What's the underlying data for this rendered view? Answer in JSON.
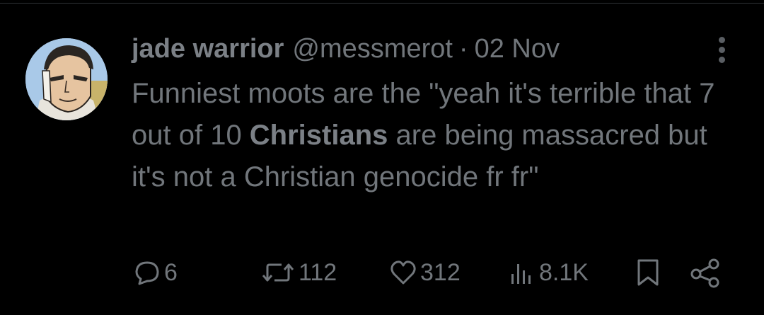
{
  "tweet": {
    "author": {
      "name": "jade warrior",
      "handle": "@messmerot"
    },
    "separator": "·",
    "date": "02 Nov",
    "text": {
      "part1": "Funniest moots are the \"yeah it's terrible that 7 out of 10 ",
      "bold": "Christians",
      "part2": " are being massacred but it's not a Christian genocide fr fr\""
    },
    "actions": {
      "replies": "6",
      "reposts": "112",
      "likes": "312",
      "views": "8.1K"
    }
  },
  "colors": {
    "background": "#000000",
    "text_muted": "#71767b",
    "avatar_sky": "#a7c7e7"
  },
  "icons": {
    "reply": "speech-bubble-icon",
    "repost": "repost-arrows-icon",
    "like": "heart-icon",
    "views": "bar-chart-icon",
    "bookmark": "bookmark-icon",
    "share": "share-nodes-icon",
    "more": "more-vertical-icon"
  }
}
